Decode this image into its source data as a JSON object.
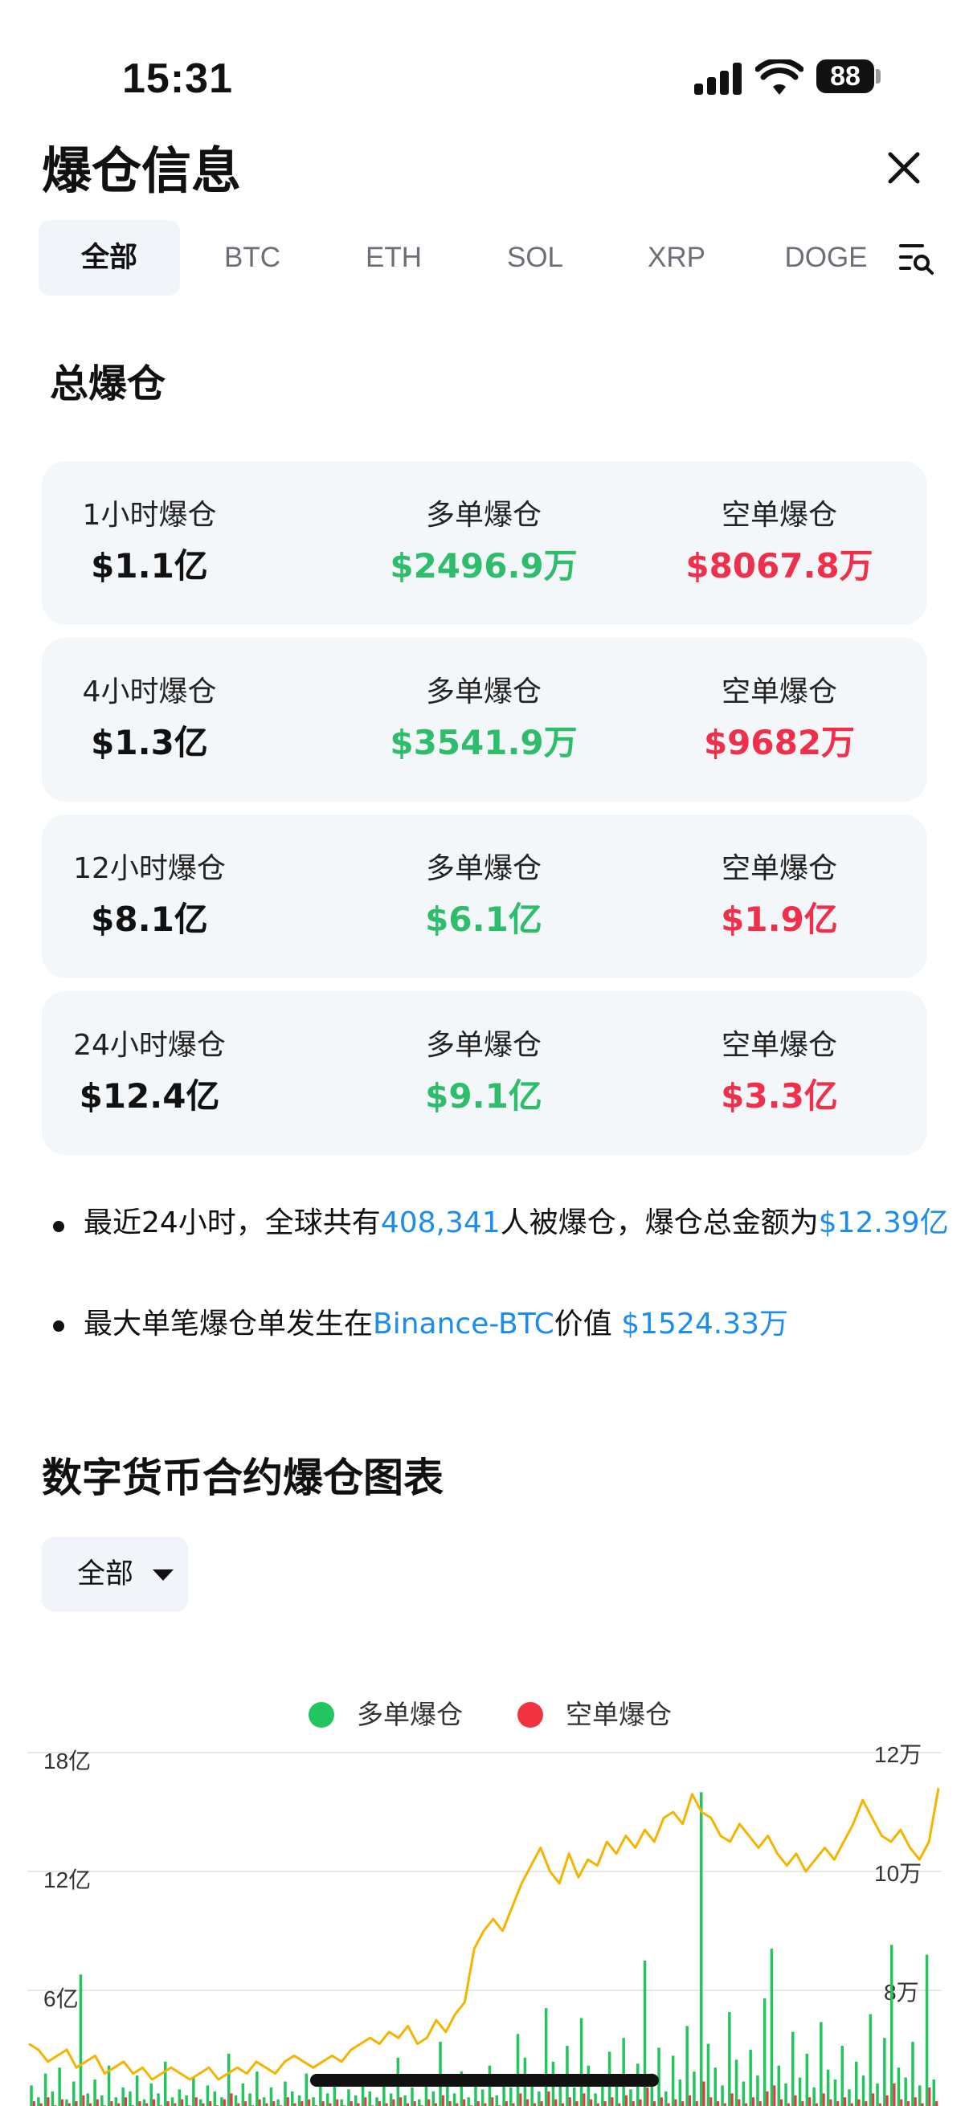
{
  "status_bar": {
    "time": "15:31",
    "battery": "88"
  },
  "header": {
    "title": "爆仓信息"
  },
  "tabs": [
    {
      "label": "全部",
      "active": true
    },
    {
      "label": "BTC",
      "active": false
    },
    {
      "label": "ETH",
      "active": false
    },
    {
      "label": "SOL",
      "active": false
    },
    {
      "label": "XRP",
      "active": false
    },
    {
      "label": "DOGE",
      "active": false
    }
  ],
  "section_title": "总爆仓",
  "stats": [
    {
      "period_label": "1小时爆仓",
      "period_value": "$1.1亿",
      "long_label": "多单爆仓",
      "long_value": "$2496.9万",
      "short_label": "空单爆仓",
      "short_value": "$8067.8万"
    },
    {
      "period_label": "4小时爆仓",
      "period_value": "$1.3亿",
      "long_label": "多单爆仓",
      "long_value": "$3541.9万",
      "short_label": "空单爆仓",
      "short_value": "$9682万"
    },
    {
      "period_label": "12小时爆仓",
      "period_value": "$8.1亿",
      "long_label": "多单爆仓",
      "long_value": "$6.1亿",
      "short_label": "空单爆仓",
      "short_value": "$1.9亿"
    },
    {
      "period_label": "24小时爆仓",
      "period_value": "$12.4亿",
      "long_label": "多单爆仓",
      "long_value": "$9.1亿",
      "short_label": "空单爆仓",
      "short_value": "$3.3亿"
    }
  ],
  "summary": {
    "line1_prefix": "最近24小时，全球共有",
    "line1_people": "408,341",
    "line1_middle": "人被爆仓，爆仓总金额为",
    "line1_amount": "$12.39亿",
    "line2_prefix": "最大单笔爆仓单发生在",
    "line2_exchange": "Binance-BTC",
    "line2_middle": "价值 ",
    "line2_amount": "$1524.33万"
  },
  "chart_section": {
    "title": "数字货币合约爆仓图表",
    "dropdown_value": "全部"
  },
  "colors": {
    "long": "#2dbd6b",
    "short": "#f0304a",
    "link": "#1c8cf0",
    "price_line": "#f5b400"
  },
  "chart_data": {
    "type": "bar",
    "legend": [
      {
        "name": "多单爆仓",
        "color": "#22c55e"
      },
      {
        "name": "空单爆仓",
        "color": "#ef3340"
      }
    ],
    "left_axis": {
      "ticks": [
        "18亿",
        "12亿",
        "6亿"
      ],
      "range": [
        0,
        18
      ]
    },
    "right_axis": {
      "ticks": [
        "12万",
        "10万",
        "8万"
      ],
      "range": [
        6,
        12
      ]
    },
    "long_bars": [
      1.2,
      0.6,
      1.8,
      0.9,
      2.1,
      0.5,
      1.4,
      6.8,
      0.8,
      1.5,
      0.7,
      2.2,
      0.6,
      1.1,
      0.9,
      1.7,
      0.5,
      1.3,
      0.8,
      2.4,
      0.6,
      1.0,
      0.7,
      1.6,
      0.5,
      1.2,
      0.9,
      0.6,
      2.8,
      0.7,
      1.3,
      0.8,
      1.9,
      0.6,
      1.1,
      0.5,
      1.4,
      0.9,
      0.7,
      1.8,
      0.6,
      1.2,
      0.8,
      1.5,
      0.5,
      1.0,
      0.7,
      1.3,
      0.9,
      0.6,
      1.2,
      0.8,
      2.6,
      0.7,
      1.1,
      0.5,
      1.6,
      0.9,
      3.4,
      1.2,
      0.8,
      1.9,
      0.6,
      1.4,
      1.0,
      2.2,
      0.7,
      1.5,
      1.1,
      3.8,
      2.6,
      1.3,
      0.9,
      5.1,
      2.4,
      1.5,
      3.2,
      1.1,
      4.6,
      2.2,
      0.8,
      1.7,
      2.9,
      1.4,
      3.6,
      1.0,
      2.3,
      7.5,
      1.8,
      3.1,
      0.9,
      2.7,
      1.5,
      4.2,
      1.9,
      16.0,
      3.3,
      2.1,
      1.2,
      4.9,
      2.5,
      1.4,
      3.0,
      1.7,
      5.6,
      8.1,
      2.2,
      1.3,
      3.9,
      1.6,
      2.8,
      1.1,
      4.4,
      2.0,
      1.5,
      3.2,
      1.0,
      2.4,
      1.7,
      4.8,
      1.3,
      3.6,
      8.3,
      2.1,
      1.6,
      3.4,
      1.2,
      7.8,
      1.5
    ],
    "short_bars": [
      0.4,
      0.3,
      0.6,
      0.2,
      0.5,
      0.3,
      0.4,
      0.7,
      0.3,
      0.5,
      0.2,
      0.4,
      0.3,
      0.6,
      0.2,
      0.4,
      0.3,
      0.5,
      0.2,
      0.4,
      0.3,
      0.5,
      0.2,
      0.6,
      0.3,
      0.4,
      0.2,
      0.5,
      0.8,
      0.3,
      0.4,
      0.2,
      0.5,
      0.3,
      0.4,
      0.2,
      0.6,
      0.3,
      0.4,
      0.5,
      0.2,
      0.4,
      0.3,
      0.5,
      0.2,
      0.4,
      0.3,
      0.6,
      0.2,
      0.4,
      0.3,
      0.5,
      0.6,
      0.3,
      0.4,
      0.2,
      0.5,
      0.3,
      0.7,
      0.4,
      0.3,
      0.5,
      0.2,
      0.4,
      0.3,
      0.6,
      0.2,
      0.4,
      0.3,
      0.8,
      0.5,
      0.3,
      0.4,
      0.9,
      0.5,
      0.3,
      0.6,
      0.4,
      0.8,
      0.5,
      0.3,
      0.4,
      0.6,
      0.3,
      0.7,
      0.4,
      0.5,
      1.1,
      0.4,
      0.6,
      0.3,
      0.5,
      0.4,
      0.7,
      0.4,
      1.4,
      0.6,
      0.4,
      0.3,
      0.8,
      0.5,
      0.3,
      0.6,
      0.4,
      0.9,
      1.2,
      0.5,
      0.3,
      0.7,
      0.4,
      0.6,
      0.3,
      0.8,
      0.5,
      0.4,
      0.6,
      0.3,
      0.5,
      0.4,
      0.8,
      0.3,
      0.7,
      1.3,
      0.5,
      0.4,
      0.6,
      0.3,
      1.1,
      0.4
    ],
    "price_line": [
      7.1,
      7.0,
      6.8,
      6.9,
      7.0,
      6.7,
      6.8,
      6.9,
      6.6,
      6.7,
      6.8,
      6.6,
      6.7,
      6.5,
      6.6,
      6.7,
      6.6,
      6.5,
      6.6,
      6.7,
      6.5,
      6.6,
      6.7,
      6.6,
      6.8,
      6.7,
      6.6,
      6.8,
      6.9,
      6.8,
      6.7,
      6.8,
      6.9,
      6.8,
      7.0,
      7.1,
      7.2,
      7.1,
      7.3,
      7.2,
      7.4,
      7.1,
      7.2,
      7.5,
      7.3,
      7.6,
      7.8,
      8.7,
      9.0,
      9.2,
      9.0,
      9.4,
      9.8,
      10.1,
      10.4,
      10.0,
      9.8,
      10.3,
      9.9,
      10.2,
      10.1,
      10.5,
      10.3,
      10.6,
      10.4,
      10.7,
      10.5,
      10.9,
      11.0,
      10.8,
      11.3,
      11.0,
      10.9,
      10.6,
      10.5,
      10.8,
      10.6,
      10.4,
      10.6,
      10.3,
      10.1,
      10.3,
      10.0,
      10.2,
      10.4,
      10.2,
      10.5,
      10.8,
      11.2,
      10.9,
      10.6,
      10.5,
      10.7,
      10.4,
      10.2,
      10.5,
      11.4
    ]
  }
}
